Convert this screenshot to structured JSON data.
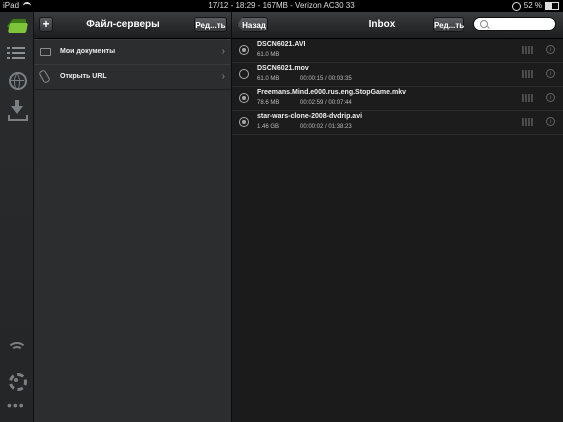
{
  "status": {
    "device": "iPad",
    "center": "17/12 - 18:29 - 167MB - Verizon AC30 33",
    "battery": "52 %"
  },
  "left_rail": {
    "items": [
      "folder-icon",
      "list-icon",
      "globe-icon",
      "download-icon"
    ],
    "bottom_items": [
      "wifi-icon",
      "gear-icon",
      "more-icon"
    ],
    "more_glyph": "•••"
  },
  "servers_pane": {
    "add_label": "+",
    "title": "Файл-серверы",
    "edit_label": "Ред...ть",
    "items": [
      {
        "label": "Мои документы",
        "icon": "drive-icon"
      },
      {
        "label": "Открыть URL",
        "icon": "paperclip-icon"
      }
    ],
    "chevron": "›"
  },
  "files_pane": {
    "back_label": "Назад",
    "title": "Inbox",
    "edit_label": "Ред...ть",
    "search_placeholder": "",
    "files": [
      {
        "name": "DSCN6021.AVI",
        "size": "61.0 MB",
        "duration": ""
      },
      {
        "name": "DSCN6021.mov",
        "size": "61.0 MB",
        "duration": "00:00:15 / 00:03:35"
      },
      {
        "name": "Freemans.Mind.e000.rus.eng.StopGame.mkv",
        "size": "78.6 MB",
        "duration": "00:02:59 / 00:07:44"
      },
      {
        "name": "star-wars-clone-2008-dvdrip.avi",
        "size": "1.46 GB",
        "duration": "00:00:02 / 01:38:23"
      }
    ],
    "info_glyph": "i"
  }
}
